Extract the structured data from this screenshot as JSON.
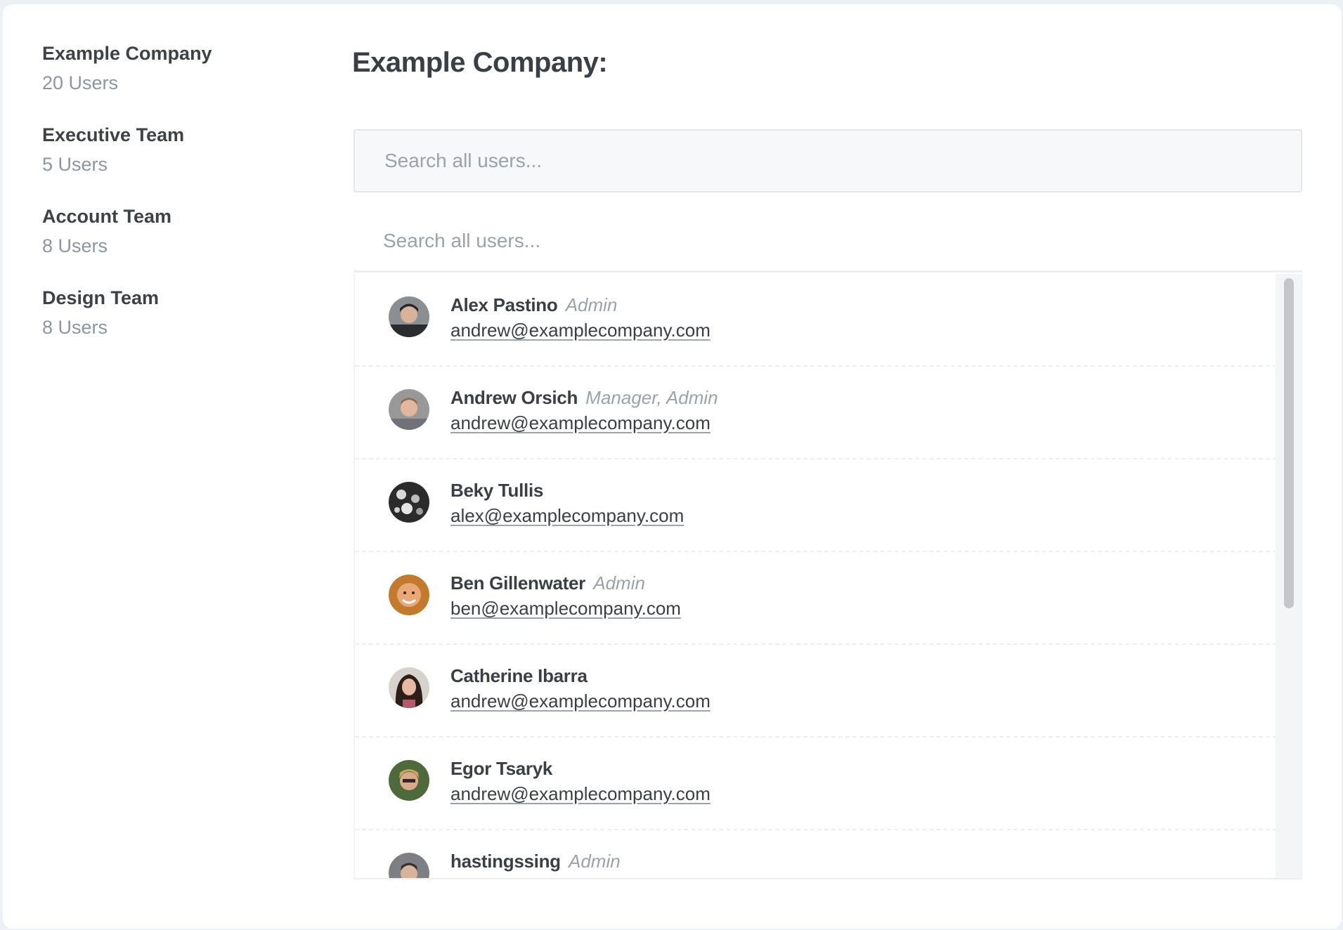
{
  "sidebar": {
    "groups": [
      {
        "name": "Example Company",
        "count": "20 Users"
      },
      {
        "name": "Executive Team",
        "count": "5 Users"
      },
      {
        "name": "Account Team",
        "count": "8 Users"
      },
      {
        "name": "Design Team",
        "count": "8 Users"
      }
    ]
  },
  "main": {
    "title": "Example Company:",
    "search_placeholder": "Search all users...",
    "filter_placeholder": "Search all users..."
  },
  "users": [
    {
      "name": "Alex Pastino",
      "role": "Admin",
      "email": "andrew@examplecompany.com"
    },
    {
      "name": "Andrew Orsich",
      "role": "Manager, Admin",
      "email": "andrew@examplecompany.com"
    },
    {
      "name": "Beky Tullis",
      "role": "",
      "email": "alex@examplecompany.com"
    },
    {
      "name": "Ben Gillenwater",
      "role": "Admin",
      "email": "ben@examplecompany.com"
    },
    {
      "name": "Catherine Ibarra",
      "role": "",
      "email": "andrew@examplecompany.com"
    },
    {
      "name": "Egor Tsaryk",
      "role": "",
      "email": "andrew@examplecompany.com"
    },
    {
      "name": "hastingssing",
      "role": "Admin",
      "email": ""
    }
  ],
  "colors": {
    "background": "#edf0f4",
    "card": "#ffffff",
    "text": "#3a3f47",
    "muted": "#8c96a3",
    "role": "#9aa2ad"
  },
  "icons": [
    "avatar-photo"
  ]
}
